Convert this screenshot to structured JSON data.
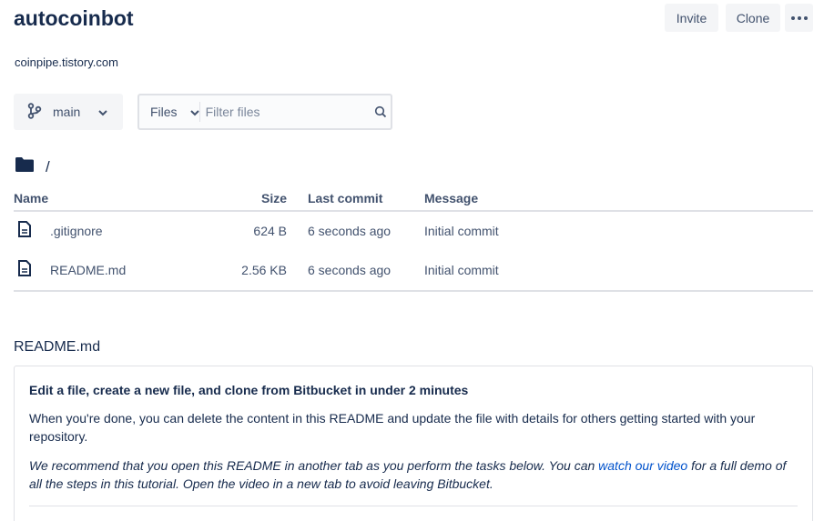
{
  "repo": {
    "title": "autocoinbot",
    "description": "coinpipe.tistory.com"
  },
  "header_actions": {
    "invite_label": "Invite",
    "clone_label": "Clone",
    "more_icon": "more-horizontal-icon"
  },
  "branch": {
    "label": "main",
    "icon": "branch-icon"
  },
  "filter": {
    "dropdown_label": "Files",
    "placeholder": "Filter files",
    "value": ""
  },
  "path": {
    "folder_icon": "folder-icon",
    "current": "/"
  },
  "table": {
    "headers": {
      "name": "Name",
      "size": "Size",
      "last_commit": "Last commit",
      "message": "Message"
    },
    "rows": [
      {
        "name": ".gitignore",
        "size": "624 B",
        "last_commit": "6 seconds ago",
        "message": "Initial commit",
        "icon": "file-icon"
      },
      {
        "name": "README.md",
        "size": "2.56 KB",
        "last_commit": "6 seconds ago",
        "message": "Initial commit",
        "icon": "file-icon"
      }
    ]
  },
  "readme": {
    "filename": "README.md",
    "heading": "Edit a file, create a new file, and clone from Bitbucket in under 2 minutes",
    "para1": "When you're done, you can delete the content in this README and update the file with details for others getting started with your repository.",
    "para2_before": "We recommend that you open this README in another tab as you perform the tasks below. You can ",
    "para2_link": "watch our video",
    "para2_after": " for a full demo of all the steps in this tutorial. Open the video in a new tab to avoid leaving Bitbucket."
  },
  "colors": {
    "text": "#172b4d",
    "muted": "#42526e",
    "link": "#0052cc",
    "button_bg": "#f4f5f7",
    "border": "#dfe1e6"
  }
}
